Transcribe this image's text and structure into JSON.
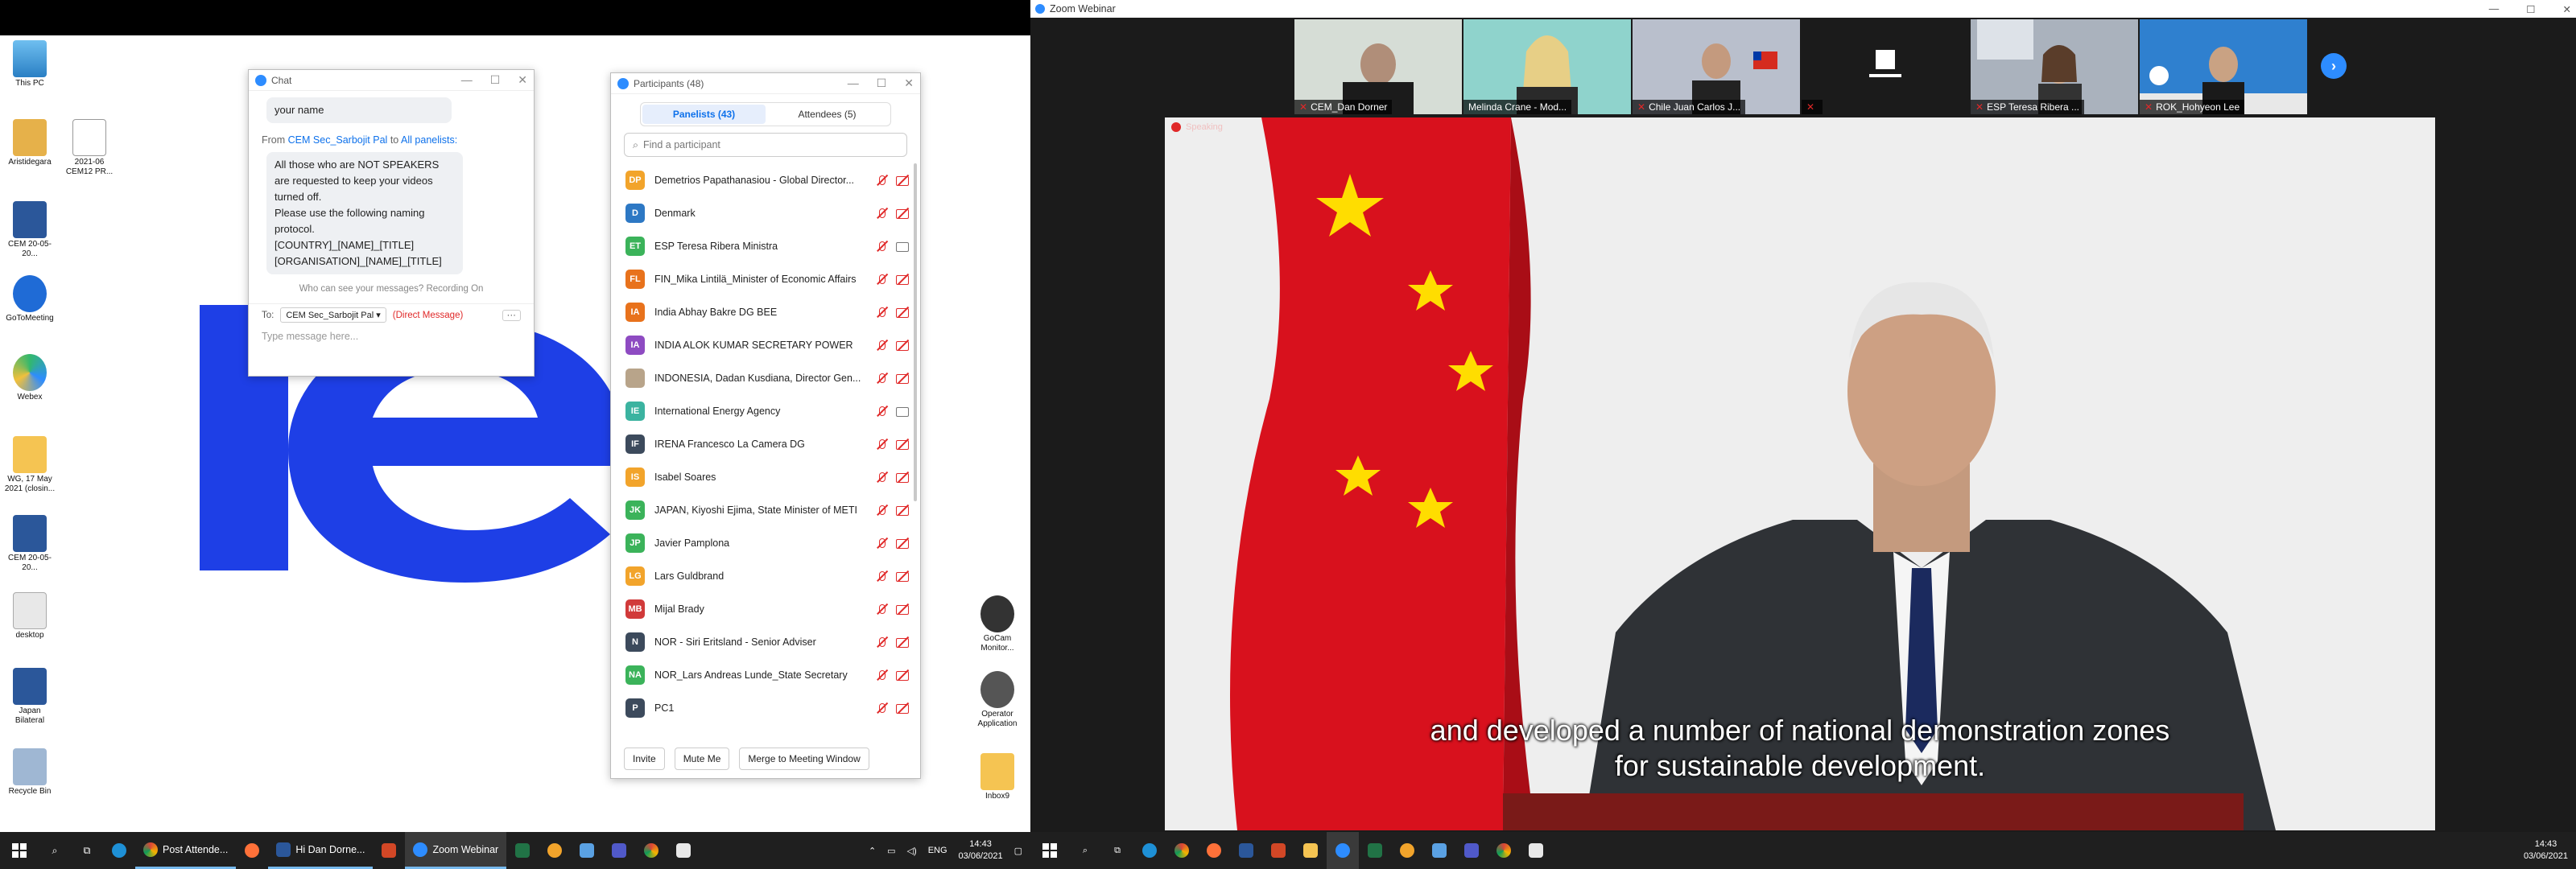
{
  "left": {
    "desktop_icons": [
      {
        "label": "This PC",
        "icon": "computer-icon",
        "color": "#4aa3df"
      },
      {
        "label": "Aristidegara",
        "icon": "user-folder-icon",
        "color": "#e6b14a"
      },
      {
        "label": "2021-06 CEM12 PR...",
        "icon": "pdf-icon",
        "color": "#ffffff"
      },
      {
        "label": "CEM 20-05-20...",
        "icon": "word-icon",
        "color": "#2b579a"
      },
      {
        "label": "GoToMeeting",
        "icon": "gotomeeting-icon",
        "color": "#1f6bd6"
      },
      {
        "label": "Webex",
        "icon": "webex-icon",
        "color": "#33b86d"
      },
      {
        "label": "WG, 17 May 2021 (closin...",
        "icon": "folder-icon",
        "color": "#f5c452"
      },
      {
        "label": "CEM 20-05-20...",
        "icon": "word-icon",
        "color": "#2b579a"
      },
      {
        "label": "desktop",
        "icon": "file-icon",
        "color": "#dddddd"
      },
      {
        "label": "Japan Bilateral",
        "icon": "word-icon",
        "color": "#2b579a"
      },
      {
        "label": "Recycle Bin",
        "icon": "recycle-bin-icon",
        "color": "#9fb7d3"
      }
    ],
    "right_icons": [
      {
        "label": "GoCam Monitor...",
        "icon": "camera-app-icon"
      },
      {
        "label": "Operator Application",
        "icon": "podcast-icon"
      },
      {
        "label": "Inbox9",
        "icon": "inbox-icon"
      }
    ],
    "chat": {
      "title": "Chat",
      "prev_message": "your name",
      "from_prefix": "From",
      "from_sender": "CEM Sec_Sarbojit Pal",
      "from_to": "to",
      "from_recipient": "All panelists",
      "message_lines": [
        "All those who are NOT SPEAKERS",
        "are requested to keep your videos",
        "turned off.",
        "Please use the following naming",
        "protocol.",
        "[COUNTRY]_[NAME]_[TITLE]",
        "[ORGANISATION]_[NAME]_[TITLE]"
      ],
      "notice": "Who can see your messages? Recording On",
      "to_label": "To:",
      "to_value": "CEM Sec_Sarbojit Pal",
      "to_mode": "(Direct Message)",
      "input_placeholder": "Type message here..."
    },
    "participants": {
      "title": "Participants (48)",
      "tab_panelists": "Panelists (43)",
      "tab_attendees": "Attendees (5)",
      "search_placeholder": "Find a participant",
      "rows": [
        {
          "initials": "DP",
          "name": "Demetrios Papathanasiou - Global Director...",
          "color": "#f2a42b",
          "cam": "off"
        },
        {
          "initials": "D",
          "name": "Denmark",
          "color": "#2d78c4",
          "cam": "off"
        },
        {
          "initials": "ET",
          "name": "ESP Teresa Ribera Ministra",
          "color": "#3bb35a",
          "cam": "on"
        },
        {
          "initials": "FL",
          "name": "FIN_Mika Lintilä_Minister of Economic Affairs",
          "color": "#e8721c",
          "cam": "off"
        },
        {
          "initials": "IA",
          "name": "India Abhay Bakre DG BEE",
          "color": "#e8721c",
          "cam": "off"
        },
        {
          "initials": "IA",
          "name": "INDIA ALOK KUMAR SECRETARY POWER",
          "color": "#8e4bc2",
          "cam": "off"
        },
        {
          "initials": "",
          "name": "INDONESIA, Dadan Kusdiana, Director Gen...",
          "color": "#b8a48a",
          "cam": "off"
        },
        {
          "initials": "IE",
          "name": "International Energy Agency",
          "color": "#3bb3a0",
          "cam": "on"
        },
        {
          "initials": "IF",
          "name": "IRENA Francesco La Camera DG",
          "color": "#3c4a5c",
          "cam": "off"
        },
        {
          "initials": "IS",
          "name": "Isabel Soares",
          "color": "#f2a42b",
          "cam": "off"
        },
        {
          "initials": "JK",
          "name": "JAPAN, Kiyoshi Ejima, State Minister of METI",
          "color": "#3bb35a",
          "cam": "off"
        },
        {
          "initials": "JP",
          "name": "Javier Pamplona",
          "color": "#3bb35a",
          "cam": "off"
        },
        {
          "initials": "LG",
          "name": "Lars Guldbrand",
          "color": "#f2a42b",
          "cam": "off"
        },
        {
          "initials": "MB",
          "name": "Mijal Brady",
          "color": "#d13a3a",
          "cam": "off"
        },
        {
          "initials": "N",
          "name": "NOR - Siri Eritsland - Senior Adviser",
          "color": "#3c4a5c",
          "cam": "off"
        },
        {
          "initials": "NA",
          "name": "NOR_Lars Andreas Lunde_State Secretary",
          "color": "#3bb35a",
          "cam": "off"
        },
        {
          "initials": "P",
          "name": "PC1",
          "color": "#3c4a5c",
          "cam": "off"
        }
      ],
      "btn_invite": "Invite",
      "btn_mute": "Mute Me",
      "btn_merge": "Merge to Meeting Window"
    },
    "taskbar": {
      "apps": [
        {
          "label": "Post Attende...",
          "icon": "chrome-icon",
          "color": "#e8a430"
        },
        {
          "label": "Hi Dan Dorne...",
          "icon": "word-icon",
          "color": "#2b579a"
        },
        {
          "label": "Zoom Webinar",
          "icon": "zoom-icon",
          "color": "#2d8cff"
        }
      ],
      "lang": "ENG",
      "time": "14:43",
      "date": "03/06/2021"
    }
  },
  "right": {
    "window_title": "Zoom Webinar",
    "thumbnails": [
      {
        "name": "CEM_Dan Dorner",
        "bg": "#cfd8cf"
      },
      {
        "name": "Melinda Crane - Mod...",
        "bg": "#9fd8d4"
      },
      {
        "name": "Chile Juan Carlos J...",
        "bg": "#c9cdd6"
      },
      {
        "name": "",
        "bg": "#1b1b1b"
      },
      {
        "name": "ESP Teresa Ribera ...",
        "bg": "#b5bcc7"
      },
      {
        "name": "ROK_Hohyeon Lee",
        "bg": "#2c7bc9"
      }
    ],
    "speaker_status": "Speaking",
    "caption_line1": "and developed a number of national demonstration zones",
    "caption_line2": "for sustainable development.",
    "taskbar": {
      "time": "14:43",
      "date": "03/06/2021"
    }
  }
}
